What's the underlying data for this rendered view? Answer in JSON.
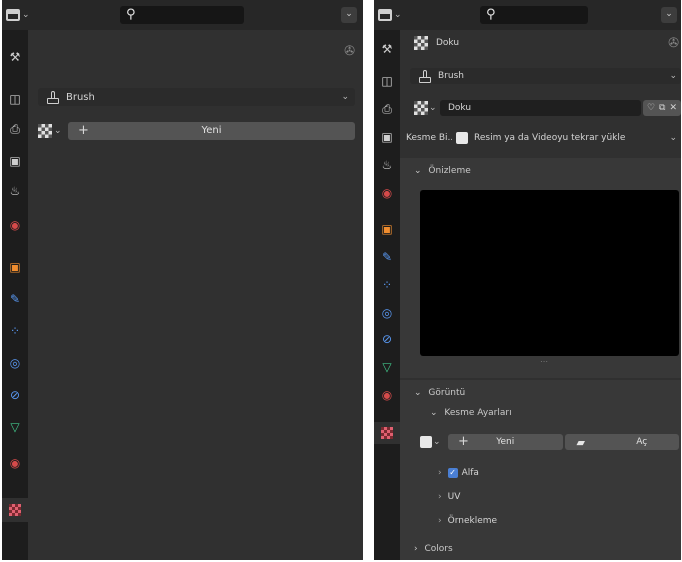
{
  "left_panel": {
    "search": {
      "placeholder": ""
    },
    "brush_selector": {
      "label": "Brush"
    },
    "texture_row": {
      "new_button": "Yeni"
    }
  },
  "right_panel": {
    "search": {
      "placeholder": ""
    },
    "context_label": "Doku",
    "brush_selector": {
      "label": "Brush"
    },
    "texture_field": {
      "value": "Doku"
    },
    "image_row": {
      "label": "Kesme Bi...",
      "value": "Resim ya da Videoyu tekrar yükle"
    },
    "preview_section": {
      "title": "Önizleme"
    },
    "image_section": {
      "title": "Görüntü",
      "subsection_title": "Kesme Ayarları",
      "new_label": "Yeni",
      "open_label": "Aç",
      "alpha_label": "Alfa",
      "uv_label": "UV",
      "sampling_label": "Örnekleme"
    },
    "colors_section": {
      "title": "Colors"
    }
  },
  "icons": {
    "tool": "tool-icon",
    "render": "render-icon",
    "output": "output-icon",
    "view_layer": "view-layer-icon",
    "scene": "scene-icon",
    "world": "world-icon",
    "object": "object-icon",
    "modifier": "wrench-icon",
    "particles": "particles-icon",
    "physics": "physics-icon",
    "constraints": "constraints-icon",
    "data": "mesh-data-icon",
    "material": "material-icon",
    "texture": "texture-icon"
  },
  "colors": {
    "panel_bg": "#303030",
    "tab_bg": "#1d1d1d",
    "header_bg": "#272727",
    "button_bg": "#545454",
    "accent_blue": "#4a7fd4"
  }
}
